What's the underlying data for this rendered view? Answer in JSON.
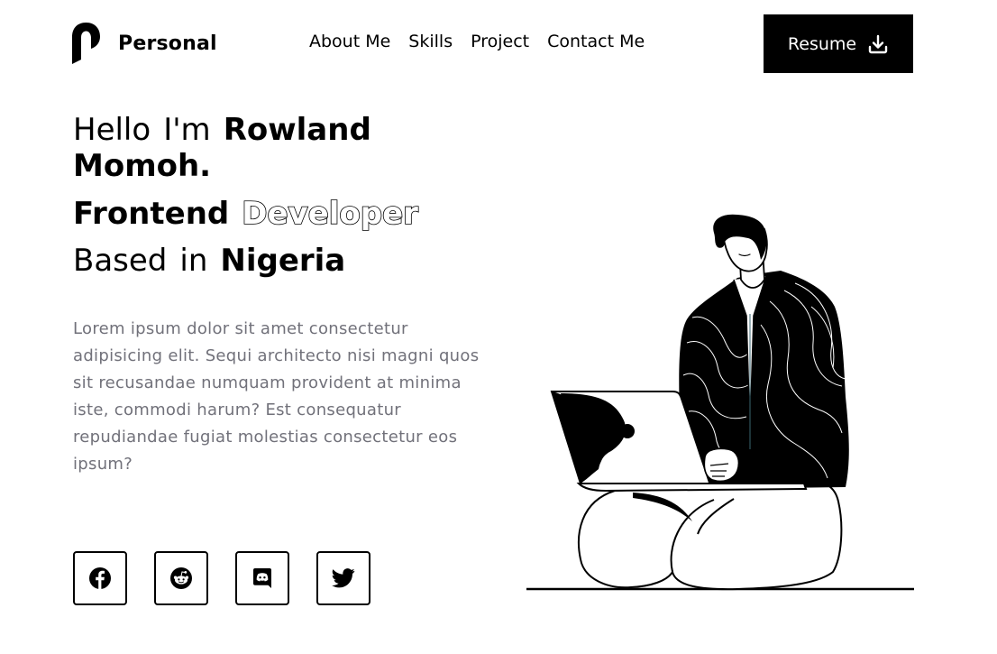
{
  "brand": {
    "name": "Personal",
    "logo_icon": "p-logo-icon"
  },
  "nav": {
    "items": [
      {
        "label": "About Me"
      },
      {
        "label": "Skills"
      },
      {
        "label": "Project"
      },
      {
        "label": "Contact Me"
      }
    ]
  },
  "resume": {
    "label": "Resume",
    "icon": "download-icon"
  },
  "hero": {
    "greeting": "Hello",
    "im": "I'm",
    "first_name": "Rowland",
    "last_name": "Momoh.",
    "role_strong": "Frontend",
    "role_outline": "Developer",
    "based": "Based",
    "in": "in",
    "location": "Nigeria",
    "intro": "Lorem ipsum dolor sit amet consectetur adipisicing elit. Sequi architecto nisi magni quos sit recusandae numquam provident at minima iste, commodi harum? Est consequatur repudiandae fugiat molestias consectetur eos ipsum?"
  },
  "socials": [
    {
      "icon": "facebook-icon"
    },
    {
      "icon": "reddit-icon"
    },
    {
      "icon": "discord-icon"
    },
    {
      "icon": "twitter-icon"
    }
  ],
  "colors": {
    "primary": "#000000",
    "background": "#ffffff",
    "body_text": "#71717a"
  }
}
